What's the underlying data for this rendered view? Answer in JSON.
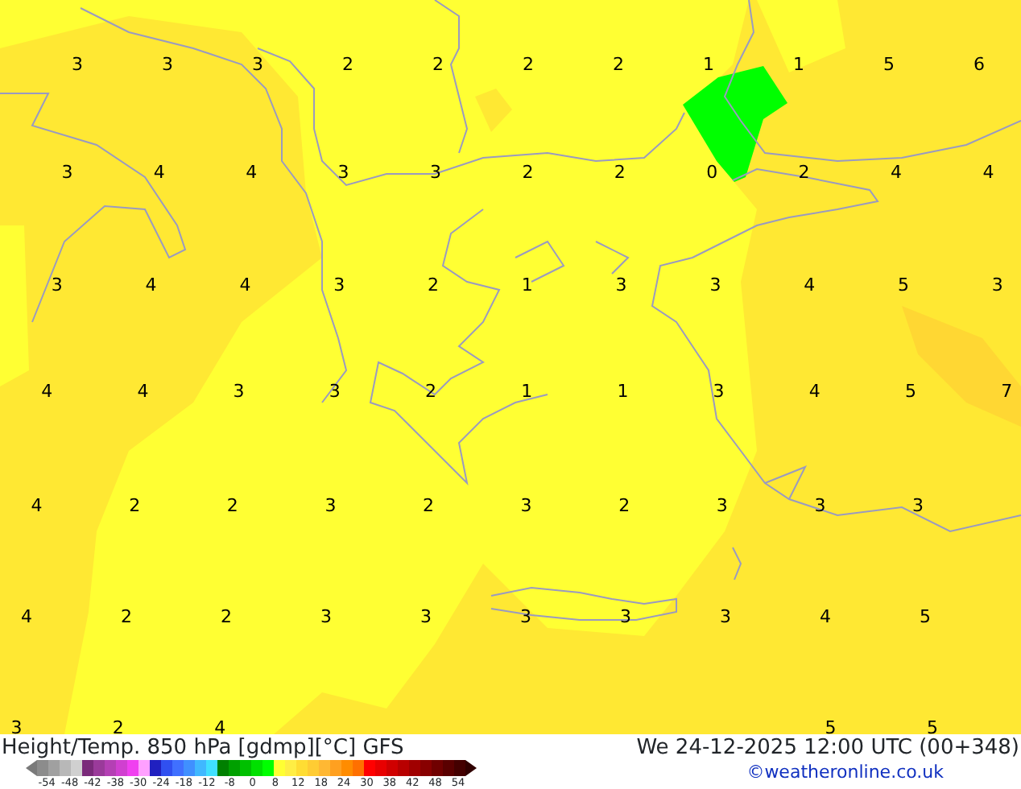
{
  "map": {
    "value_rows": [
      [
        "3",
        "3",
        "3",
        "2",
        "2",
        "2",
        "2",
        "1",
        "1",
        "5",
        "6"
      ],
      [
        "3",
        "4",
        "4",
        "3",
        "3",
        "2",
        "2",
        "0",
        "2",
        "4",
        "4"
      ],
      [
        "3",
        "4",
        "4",
        "3",
        "2",
        "1",
        "3",
        "3",
        "4",
        "5",
        "3"
      ],
      [
        "4",
        "4",
        "3",
        "3",
        "2",
        "1",
        "1",
        "3",
        "4",
        "5",
        "7"
      ],
      [
        "4",
        "2",
        "2",
        "3",
        "2",
        "3",
        "2",
        "3",
        "3",
        "3"
      ],
      [
        "4",
        "2",
        "2",
        "3",
        "3",
        "3",
        "3",
        "3",
        "4",
        "5"
      ],
      [
        "3",
        "2",
        "4",
        null,
        null,
        null,
        null,
        null,
        "5",
        "5"
      ]
    ]
  },
  "footer": {
    "title": "Height/Temp. 850 hPa [gdmp][°C] GFS",
    "valid_time": "We 24-12-2025 12:00 UTC (00+348)",
    "credit": "©weatheronline.co.uk"
  },
  "legend": {
    "swatches": [
      {
        "color": "#7a7a7a"
      },
      {
        "color": "#8c8c8c"
      },
      {
        "color": "#a0a0a0"
      },
      {
        "color": "#b8b8b8"
      },
      {
        "color": "#d0d0d0"
      },
      {
        "color": "#7a2a7a"
      },
      {
        "color": "#9a3a9a"
      },
      {
        "color": "#b440b4"
      },
      {
        "color": "#d040d0"
      },
      {
        "color": "#f040f0"
      },
      {
        "color": "#ffa0ff"
      },
      {
        "color": "#2020c0"
      },
      {
        "color": "#3050f0"
      },
      {
        "color": "#4070ff"
      },
      {
        "color": "#4090ff"
      },
      {
        "color": "#40b8ff"
      },
      {
        "color": "#40e0ff"
      },
      {
        "color": "#008000"
      },
      {
        "color": "#00a000"
      },
      {
        "color": "#00c000"
      },
      {
        "color": "#00e000"
      },
      {
        "color": "#00ff00"
      },
      {
        "color": "#ffff33"
      },
      {
        "color": "#ffee44"
      },
      {
        "color": "#ffdd33"
      },
      {
        "color": "#ffcc33"
      },
      {
        "color": "#ffb833"
      },
      {
        "color": "#ffa020"
      },
      {
        "color": "#ff8c00"
      },
      {
        "color": "#ff7000"
      },
      {
        "color": "#ff0000"
      },
      {
        "color": "#e80000"
      },
      {
        "color": "#d00000"
      },
      {
        "color": "#b80000"
      },
      {
        "color": "#a00000"
      },
      {
        "color": "#880000"
      },
      {
        "color": "#700000"
      },
      {
        "color": "#5a0000"
      },
      {
        "color": "#440000"
      },
      {
        "color": "#300000"
      }
    ],
    "ticks": [
      "-54",
      "-48",
      "-42",
      "-38",
      "-30",
      "-24",
      "-18",
      "-12",
      "-8",
      "0",
      "8",
      "12",
      "18",
      "24",
      "30",
      "38",
      "42",
      "48",
      "54"
    ]
  }
}
